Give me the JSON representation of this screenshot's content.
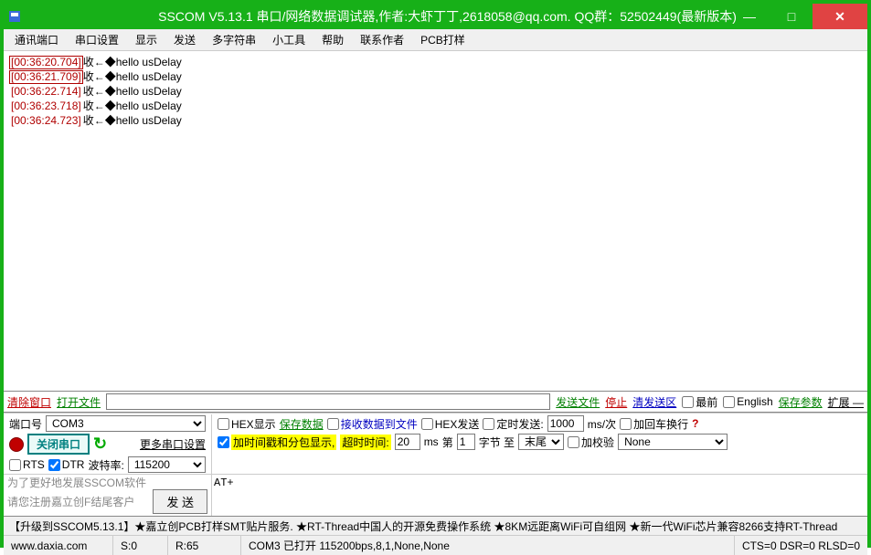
{
  "title": "SSCOM V5.13.1 串口/网络数据调试器,作者:大虾丁丁,2618058@qq.com. QQ群：52502449(最新版本)",
  "menu": [
    "通讯端口",
    "串口设置",
    "显示",
    "发送",
    "多字符串",
    "小工具",
    "帮助",
    "联系作者",
    "PCB打样"
  ],
  "log": [
    {
      "ts": "[00:36:20.704]",
      "hl": true,
      "txt": "收←◆hello usDelay"
    },
    {
      "ts": "[00:36:21.709]",
      "hl": true,
      "txt": "收←◆hello usDelay"
    },
    {
      "ts": "[00:36:22.714]",
      "hl": false,
      "txt": "收←◆hello usDelay"
    },
    {
      "ts": "[00:36:23.718]",
      "hl": false,
      "txt": "收←◆hello usDelay"
    },
    {
      "ts": "[00:36:24.723]",
      "hl": false,
      "txt": "收←◆hello usDelay"
    }
  ],
  "tb": {
    "clear": "清除窗口",
    "open": "打开文件",
    "sendfile": "发送文件",
    "stop": "停止",
    "clearsend": "清发送区",
    "front": "最前",
    "english": "English",
    "save": "保存参数",
    "expand": "扩展 —"
  },
  "row1l": {
    "portlabel": "端口号",
    "port": "COM3"
  },
  "row1r": {
    "hexshow": "HEX显示",
    "savedata": "保存数据",
    "rx2file": "接收数据到文件",
    "hexsend": "HEX发送",
    "timer": "定时发送:",
    "interval": "1000",
    "unit": "ms/次",
    "crlf": "加回车换行"
  },
  "row2l": {
    "closeport": "关闭串口",
    "more": "更多串口设置"
  },
  "row2r": {
    "addts": "加时间戳和分包显示,",
    "to_l": "超时时间:",
    "to_v": "20",
    "to_u": "ms",
    "nth_l": "第",
    "nth_v": "1",
    "nth_u": "字节 至",
    "endsel": "末尾",
    "chklbl": "加校验",
    "chkval": "None"
  },
  "row3l": {
    "rts": "RTS",
    "dtr": "DTR",
    "baudlbl": "波特率:",
    "baud": "115200"
  },
  "send": {
    "note1": "为了更好地发展SSCOM软件",
    "note2": "请您注册嘉立创F结尾客户",
    "sendbtn": "发  送",
    "input": "AT+"
  },
  "promo": "【升级到SSCOM5.13.1】★嘉立创PCB打样SMT贴片服务. ★RT-Thread中国人的开源免费操作系统 ★8KM远距离WiFi可自组网 ★新一代WiFi芯片兼容8266支持RT-Thread",
  "status": {
    "site": "www.daxia.com",
    "s": "S:0",
    "r": "R:65",
    "com": "COM3 已打开 115200bps,8,1,None,None",
    "cts": "CTS=0 DSR=0 RLSD=0"
  }
}
